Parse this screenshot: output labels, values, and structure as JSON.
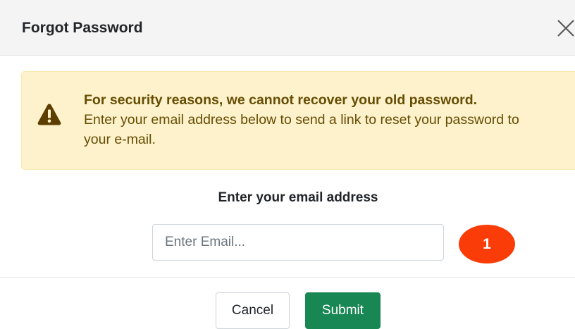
{
  "modal": {
    "title": "Forgot Password",
    "close_icon": "close-icon"
  },
  "alert": {
    "icon": "warning-triangle-icon",
    "strong_text": "For security reasons, we cannot recover your old password.",
    "body_text": "Enter your email address below to send a link to reset your password to your e-mail."
  },
  "form": {
    "label": "Enter your email address",
    "email_placeholder": "Enter Email...",
    "email_value": "",
    "step_badge": "1"
  },
  "footer": {
    "cancel_label": "Cancel",
    "submit_label": "Submit"
  },
  "colors": {
    "header_bg": "#f4f4f4",
    "alert_bg": "#fdf2cc",
    "alert_text": "#664d03",
    "badge": "#fa3c08",
    "submit": "#198754"
  }
}
